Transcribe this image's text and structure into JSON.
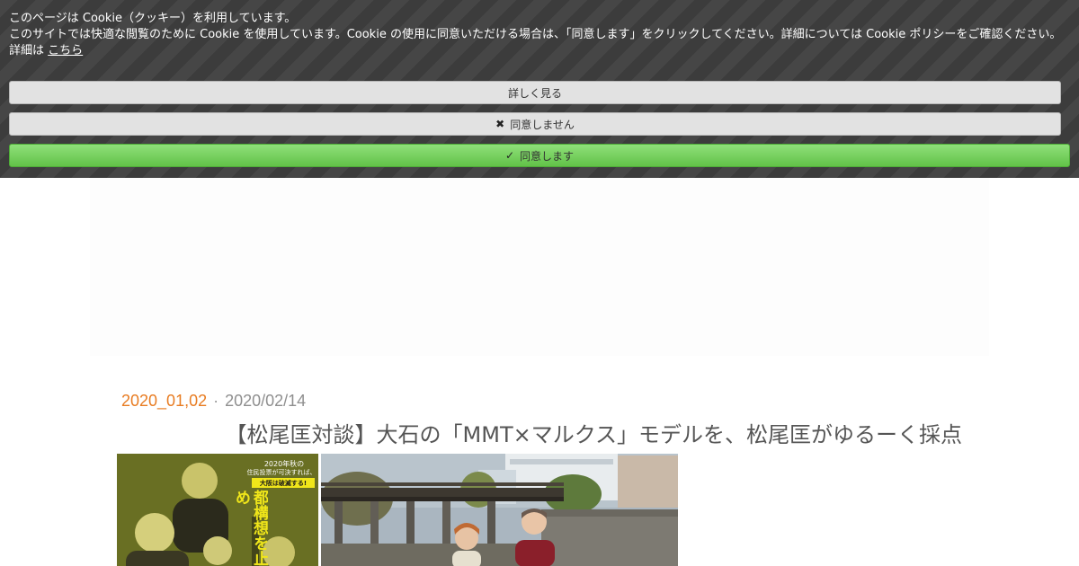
{
  "cookie_banner": {
    "line1": "このページは Cookie（クッキー）を利用しています。",
    "line2": "このサイトでは快適な閲覧のために Cookie を使用しています。Cookie の使用に同意いただける場合は、「同意します」をクリックしてください。詳細については Cookie ポリシーをご確認ください。",
    "line3_prefix": "詳細は",
    "line3_link": "こちら",
    "btn_more": "詳しく見る",
    "btn_decline": "同意しません",
    "btn_accept": "同意します",
    "decline_icon": "close-icon",
    "accept_icon": "check-icon"
  },
  "post": {
    "category": "2020_01,02",
    "separator": "·",
    "date": "2020/02/14",
    "title": "【松尾匡対談】大石の「MMT×マルクス」モデルを、松尾匡がゆるーく採点",
    "book_cover": {
      "top_line1": "2020年秋の",
      "top_line2": "住民投票が可決すれば、",
      "highlight": "大阪は破滅する!",
      "vertical_title": "都構想を止め"
    }
  },
  "colors": {
    "banner_bg": "#3c3c3c",
    "accept_green": "#6cc954",
    "category_orange": "#e87c22",
    "title_gray": "#555555"
  }
}
